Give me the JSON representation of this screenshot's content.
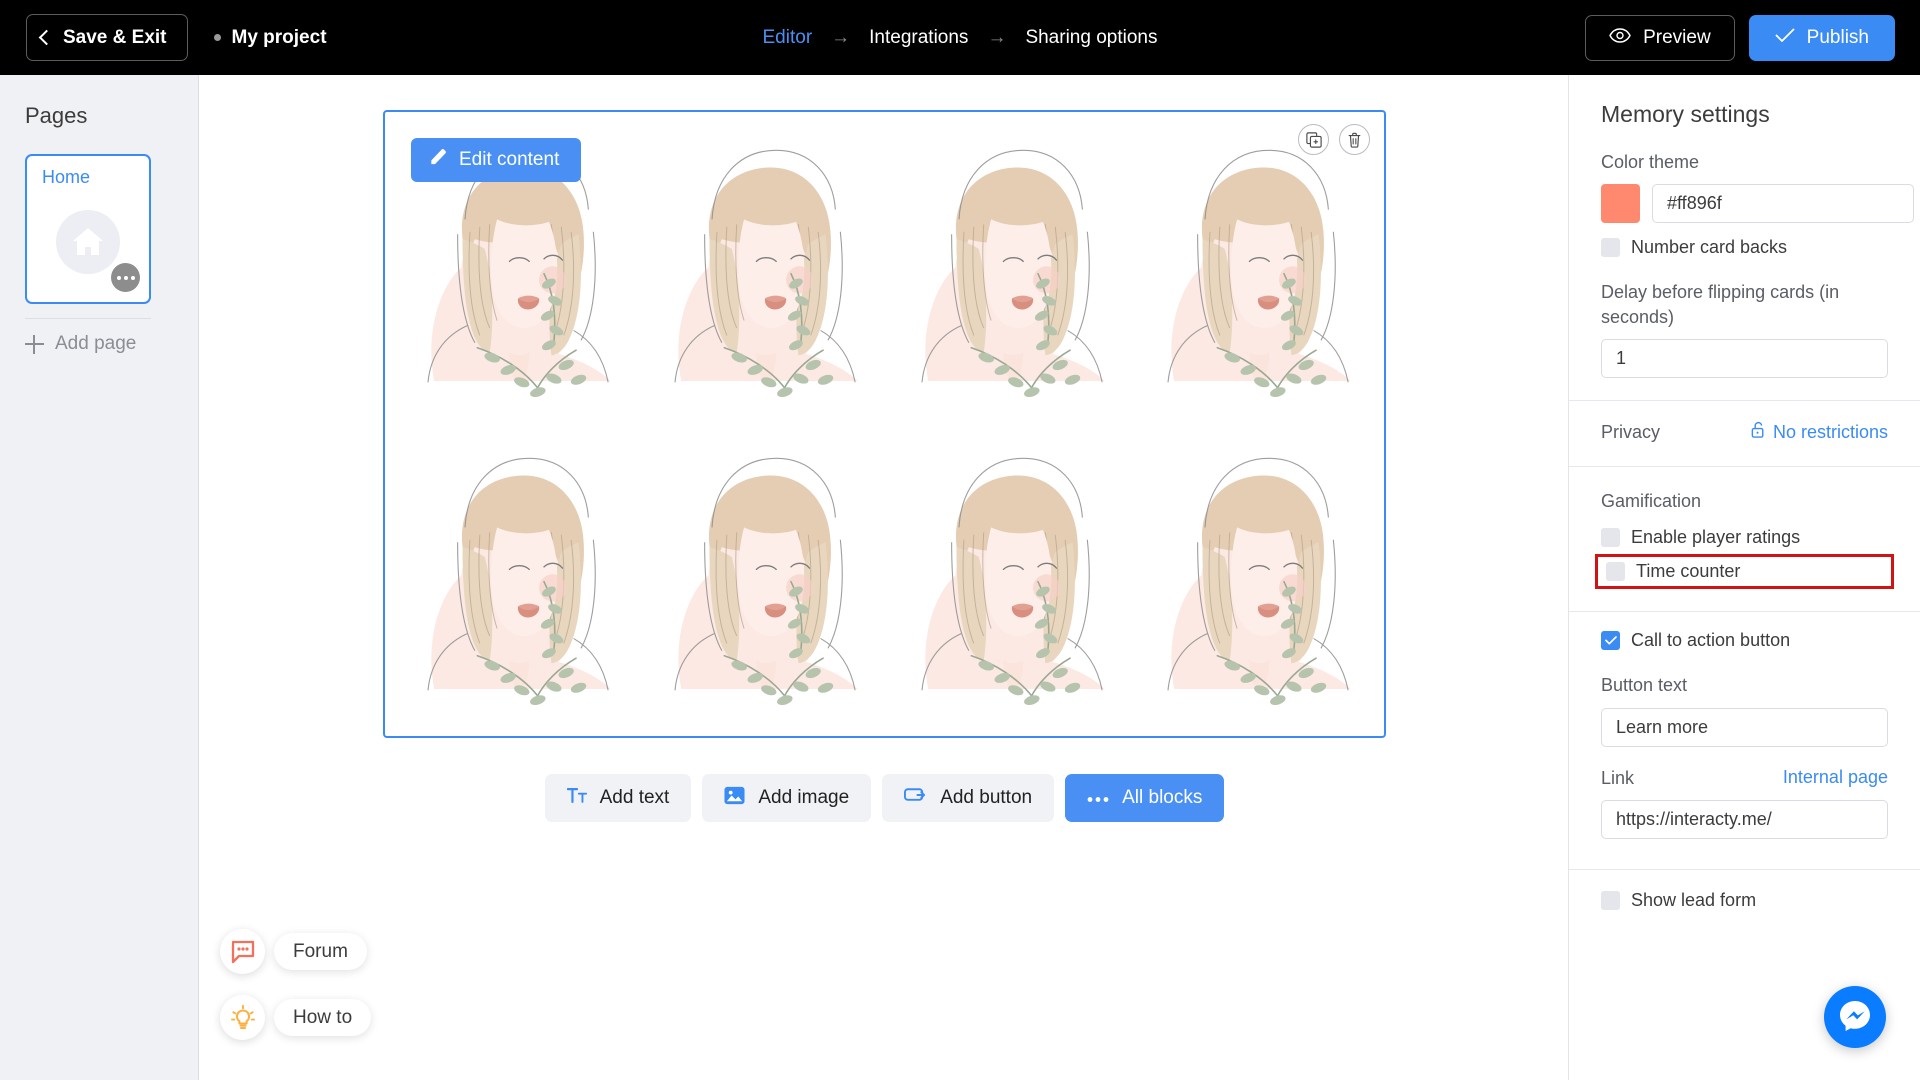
{
  "topbar": {
    "save_exit_label": "Save & Exit",
    "project_name": "My project",
    "breadcrumbs": [
      {
        "label": "Editor",
        "active": true
      },
      {
        "label": "Integrations",
        "active": false
      },
      {
        "label": "Sharing options",
        "active": false
      }
    ],
    "arrow_glyph": "→",
    "preview_label": "Preview",
    "publish_label": "Publish",
    "accent_blue": "#3b8bf4"
  },
  "sidebar": {
    "title": "Pages",
    "pages": [
      {
        "label": "Home",
        "selected": true,
        "thumb_icon": "home-icon"
      }
    ],
    "add_page_label": "Add page"
  },
  "canvas": {
    "edit_content_label": "Edit content",
    "tools": [
      {
        "name": "duplicate-icon"
      },
      {
        "name": "delete-icon"
      }
    ],
    "memory_cards_count": 8,
    "add_toolbar": [
      {
        "label": "Add text",
        "icon": "text-icon",
        "primary": false
      },
      {
        "label": "Add image",
        "icon": "image-icon",
        "primary": false
      },
      {
        "label": "Add button",
        "icon": "button-icon",
        "primary": false
      },
      {
        "label": "All blocks",
        "icon": "ellipsis-icon",
        "primary": true
      }
    ]
  },
  "help": [
    {
      "label": "Forum",
      "icon": "chat-icon",
      "color": "#f5705a"
    },
    {
      "label": "How to",
      "icon": "lightbulb-icon",
      "color": "#fbb040"
    }
  ],
  "settings": {
    "title": "Memory settings",
    "color_theme_label": "Color theme",
    "color_theme_value": "#ff896f",
    "number_card_backs_label": "Number card backs",
    "number_card_backs_checked": false,
    "delay_label": "Delay before flipping cards (in seconds)",
    "delay_value": "1",
    "privacy_label": "Privacy",
    "privacy_value": "No restrictions",
    "gamification_label": "Gamification",
    "enable_ratings_label": "Enable player ratings",
    "enable_ratings_checked": false,
    "time_counter_label": "Time counter",
    "time_counter_checked": false,
    "time_counter_highlighted": true,
    "cta_label": "Call to action button",
    "cta_checked": true,
    "button_text_label": "Button text",
    "button_text_value": "Learn more",
    "link_label": "Link",
    "internal_page_label": "Internal page",
    "link_value": "https://interacty.me/",
    "show_lead_form_label": "Show lead form",
    "show_lead_form_checked": false
  },
  "messenger": {
    "icon": "messenger-icon",
    "color": "#0a7cff"
  }
}
